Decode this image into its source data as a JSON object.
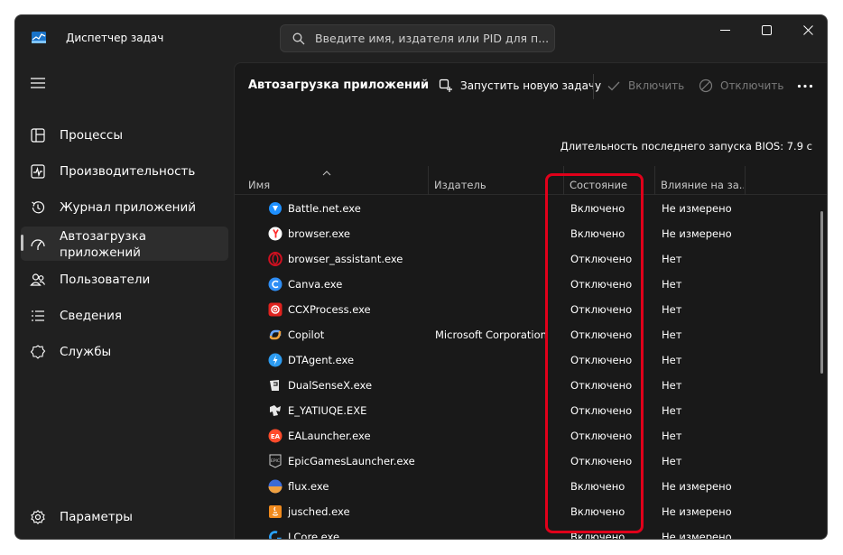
{
  "window": {
    "title": "Диспетчер задач"
  },
  "search": {
    "placeholder": "Введите имя, издателя или PID для п..."
  },
  "sidebar": {
    "items": [
      {
        "label": "Процессы",
        "icon": "processes-icon"
      },
      {
        "label": "Производительность",
        "icon": "performance-icon"
      },
      {
        "label": "Журнал приложений",
        "icon": "history-icon"
      },
      {
        "label": "Автозагрузка приложений",
        "icon": "startup-icon",
        "active": true
      },
      {
        "label": "Пользователи",
        "icon": "users-icon"
      },
      {
        "label": "Сведения",
        "icon": "details-icon"
      },
      {
        "label": "Службы",
        "icon": "services-icon"
      }
    ],
    "settings_label": "Параметры"
  },
  "page": {
    "title": "Автозагрузка приложений",
    "run_new_task": "Запустить новую задачу",
    "enable": "Включить",
    "disable": "Отключить",
    "bios_label": "Длительность последнего запуска BIOS: 7.9 с"
  },
  "table": {
    "columns": {
      "name": "Имя",
      "publisher": "Издатель",
      "state": "Состояние",
      "impact": "Влияние на за..."
    },
    "rows": [
      {
        "name": "Battle.net.exe",
        "publisher": "",
        "state": "Включено",
        "impact": "Не измерено",
        "icon": "battlenet-icon",
        "color": "#1e90ff"
      },
      {
        "name": "browser.exe",
        "publisher": "",
        "state": "Включено",
        "impact": "Не измерено",
        "icon": "yandex-browser-icon",
        "color": "#ff2d2d"
      },
      {
        "name": "browser_assistant.exe",
        "publisher": "",
        "state": "Отключено",
        "impact": "Нет",
        "icon": "opera-icon",
        "color": "#d01020"
      },
      {
        "name": "Canva.exe",
        "publisher": "",
        "state": "Отключено",
        "impact": "Нет",
        "icon": "canva-icon",
        "color": "#2f8ef5"
      },
      {
        "name": "CCXProcess.exe",
        "publisher": "",
        "state": "Отключено",
        "impact": "Нет",
        "icon": "adobe-cc-icon",
        "color": "#e0231f"
      },
      {
        "name": "Copilot",
        "publisher": "Microsoft Corporation",
        "state": "Отключено",
        "impact": "Нет",
        "icon": "copilot-icon",
        "color": "#6aa7ff"
      },
      {
        "name": "DTAgent.exe",
        "publisher": "",
        "state": "Отключено",
        "impact": "Нет",
        "icon": "daemon-tools-icon",
        "color": "#2c9bf0"
      },
      {
        "name": "DualSenseX.exe",
        "publisher": "",
        "state": "Отключено",
        "impact": "Нет",
        "icon": "dualsensex-icon",
        "color": "#e8e8e8"
      },
      {
        "name": "E_YATIUQE.EXE",
        "publisher": "",
        "state": "Отключено",
        "impact": "Нет",
        "icon": "epson-icon",
        "color": "#e8e8e8"
      },
      {
        "name": "EALauncher.exe",
        "publisher": "",
        "state": "Отключено",
        "impact": "Нет",
        "icon": "ea-icon",
        "color": "#ff4b2b"
      },
      {
        "name": "EpicGamesLauncher.exe",
        "publisher": "",
        "state": "Отключено",
        "impact": "Нет",
        "icon": "epic-games-icon",
        "color": "#d0d0d0"
      },
      {
        "name": "flux.exe",
        "publisher": "",
        "state": "Включено",
        "impact": "Не измерено",
        "icon": "flux-icon",
        "color": "#f0a040"
      },
      {
        "name": "jusched.exe",
        "publisher": "",
        "state": "Включено",
        "impact": "Не измерено",
        "icon": "java-icon",
        "color": "#f08a1d"
      },
      {
        "name": "LCore.exe",
        "publisher": "",
        "state": "Включено",
        "impact": "Не измерено",
        "icon": "logitech-icon",
        "color": "#2aa4ff"
      }
    ]
  },
  "colors": {
    "highlight": "#e0001a",
    "background": "#202020",
    "content": "#191919"
  }
}
